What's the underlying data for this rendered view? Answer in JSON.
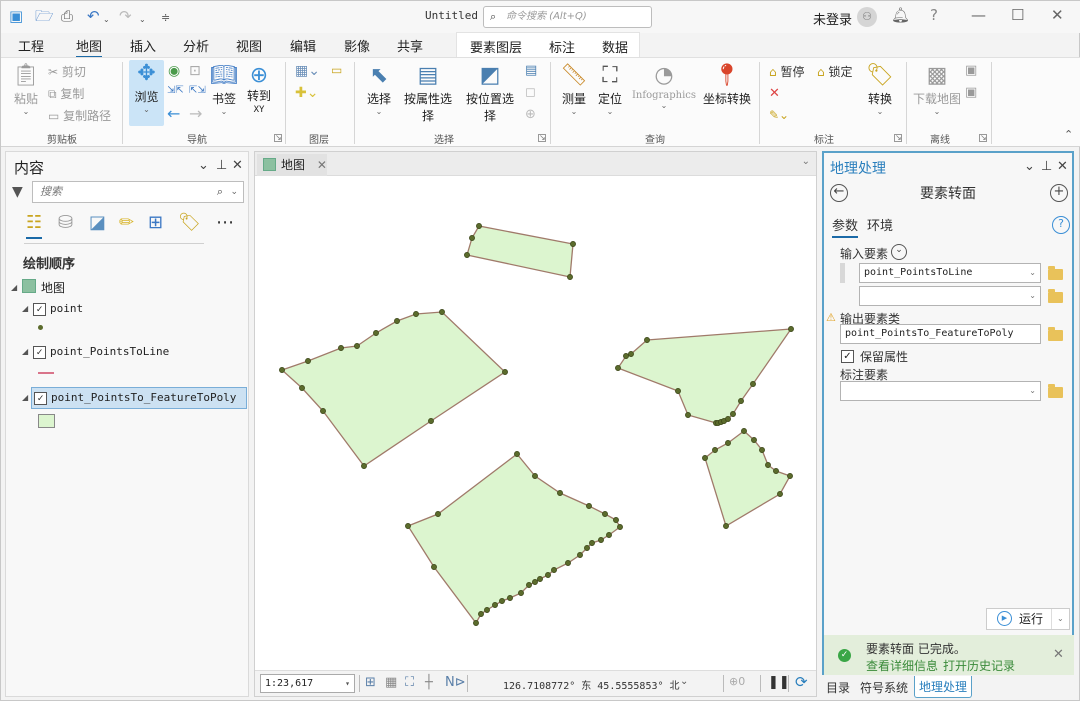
{
  "titlebar": {
    "doc_title": "Untitled",
    "command_search_placeholder": "命令搜索 (Alt+Q)",
    "login_status": "未登录",
    "quick_access": [
      "new-project-icon",
      "open-project-icon",
      "save-icon",
      "undo-icon",
      "redo-icon",
      "customize-icon"
    ]
  },
  "tabs": {
    "main": [
      "工程",
      "地图",
      "插入",
      "分析",
      "视图",
      "编辑",
      "影像",
      "共享"
    ],
    "active": "地图",
    "contextual": [
      "要素图层",
      "标注",
      "数据"
    ]
  },
  "ribbon": {
    "clipboard": {
      "label": "剪贴板",
      "paste": "粘贴",
      "cut": "剪切",
      "copy": "复制",
      "copy_path": "复制路径"
    },
    "navigate": {
      "label": "导航",
      "explore": "浏览",
      "bookmarks": "书签",
      "goto_xy_line1": "转到",
      "goto_xy_line2": "XY"
    },
    "layer": {
      "label": "图层"
    },
    "selection": {
      "label": "选择",
      "select": "选择",
      "select_by_attributes": "按属性选择",
      "select_by_location": "按位置选择"
    },
    "inquiry": {
      "label": "查询",
      "measure": "测量",
      "locate": "定位",
      "infographics": "Infographics",
      "convert_coordinates": "坐标转换"
    },
    "labeling": {
      "label": "标注",
      "pause": "暂停",
      "lock": "锁定",
      "convert": "转换"
    },
    "offline": {
      "label": "离线",
      "download_map": "下载地图"
    }
  },
  "contents": {
    "title": "内容",
    "search_placeholder": "搜索",
    "section": "绘制顺序",
    "map_name": "地图",
    "layers": [
      {
        "name": "point",
        "checked": true,
        "symbol": "point",
        "selected": false
      },
      {
        "name": "point_PointsToLine",
        "checked": true,
        "symbol": "line",
        "selected": false
      },
      {
        "name": "point_PointsTo_FeatureToPoly",
        "checked": true,
        "symbol": "polygon",
        "selected": true
      }
    ]
  },
  "map": {
    "tab_label": "地图",
    "scale": "1:23,617",
    "coordinates": "126.7108772° 东  45.5555853° 北",
    "selected_count": "0",
    "fill_color": "#dcf5cf",
    "stroke_color": "#a07a6a",
    "vertex_color": "#5b6b2c"
  },
  "geoprocessing": {
    "title": "地理处理",
    "tool_name": "要素转面",
    "tabs": [
      "参数",
      "环境"
    ],
    "active_tab": "参数",
    "input_features_label": "输入要素",
    "input_features_values": [
      "point_PointsToLine",
      ""
    ],
    "output_label": "输出要素类",
    "output_value": "point_PointsTo_FeatureToPoly",
    "keep_attributes_label": "保留属性",
    "keep_attributes_checked": true,
    "label_features_label": "标注要素",
    "label_features_value": "",
    "run_label": "运行",
    "message_title": "要素转面 已完成。",
    "message_link_details": "查看详细信息",
    "message_link_history": "打开历史记录"
  },
  "bottom_tabs": [
    "目录",
    "符号系统",
    "地理处理"
  ],
  "bottom_active": "地理处理"
}
